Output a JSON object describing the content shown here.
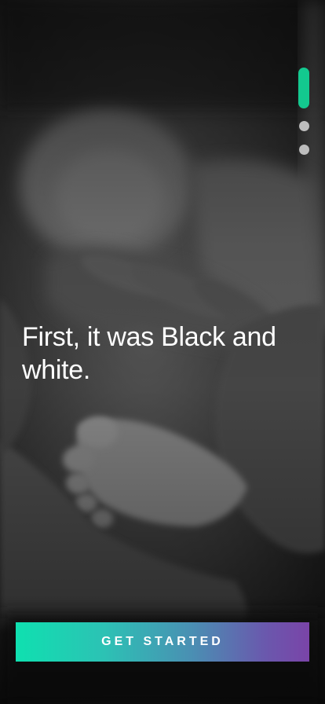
{
  "onboarding": {
    "headline": "First, it was Black and white.",
    "cta_label": "GET STARTED",
    "pagination": {
      "total": 3,
      "active_index": 0
    },
    "background_image": "grayscale-photo-baby-feet-in-hands"
  },
  "colors": {
    "accent": "#13c98f",
    "inactive_dot": "#bdbdbd",
    "gradient_start": "#0fe0b0",
    "gradient_end": "#7a44a8",
    "text": "#ffffff"
  }
}
